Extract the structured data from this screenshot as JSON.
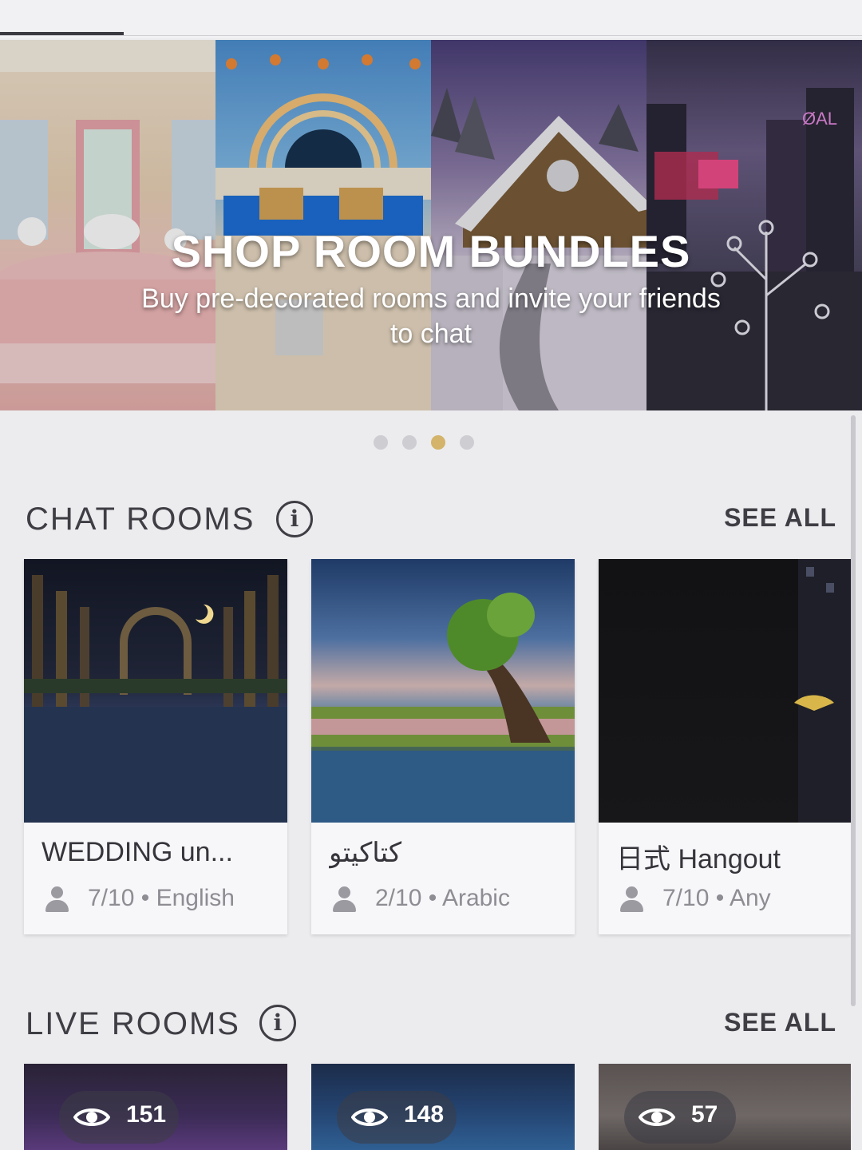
{
  "banner": {
    "title": "SHOP ROOM BUNDLES",
    "subtitle": "Buy pre-decorated rooms and invite your friends to chat",
    "dots_total": 4,
    "dots_active_index": 2,
    "active_dot_color": "#d4b36a",
    "inactive_dot_color": "#cdcdd2"
  },
  "chat_rooms": {
    "title": "CHAT ROOMS",
    "info_icon": "info-icon",
    "see_all": "SEE ALL",
    "rooms": [
      {
        "name": "WEDDING un...",
        "occupancy": "7/10",
        "language": "English"
      },
      {
        "name": "كتاكيتو",
        "occupancy": "2/10",
        "language": "Arabic"
      },
      {
        "name": "日式 Hangout",
        "occupancy": "7/10",
        "language": "Any"
      }
    ],
    "separator": "•"
  },
  "live_rooms": {
    "title": "LIVE ROOMS",
    "info_icon": "info-icon",
    "see_all": "SEE ALL",
    "rooms": [
      {
        "viewers": "151"
      },
      {
        "viewers": "148"
      },
      {
        "viewers": "57"
      }
    ]
  }
}
